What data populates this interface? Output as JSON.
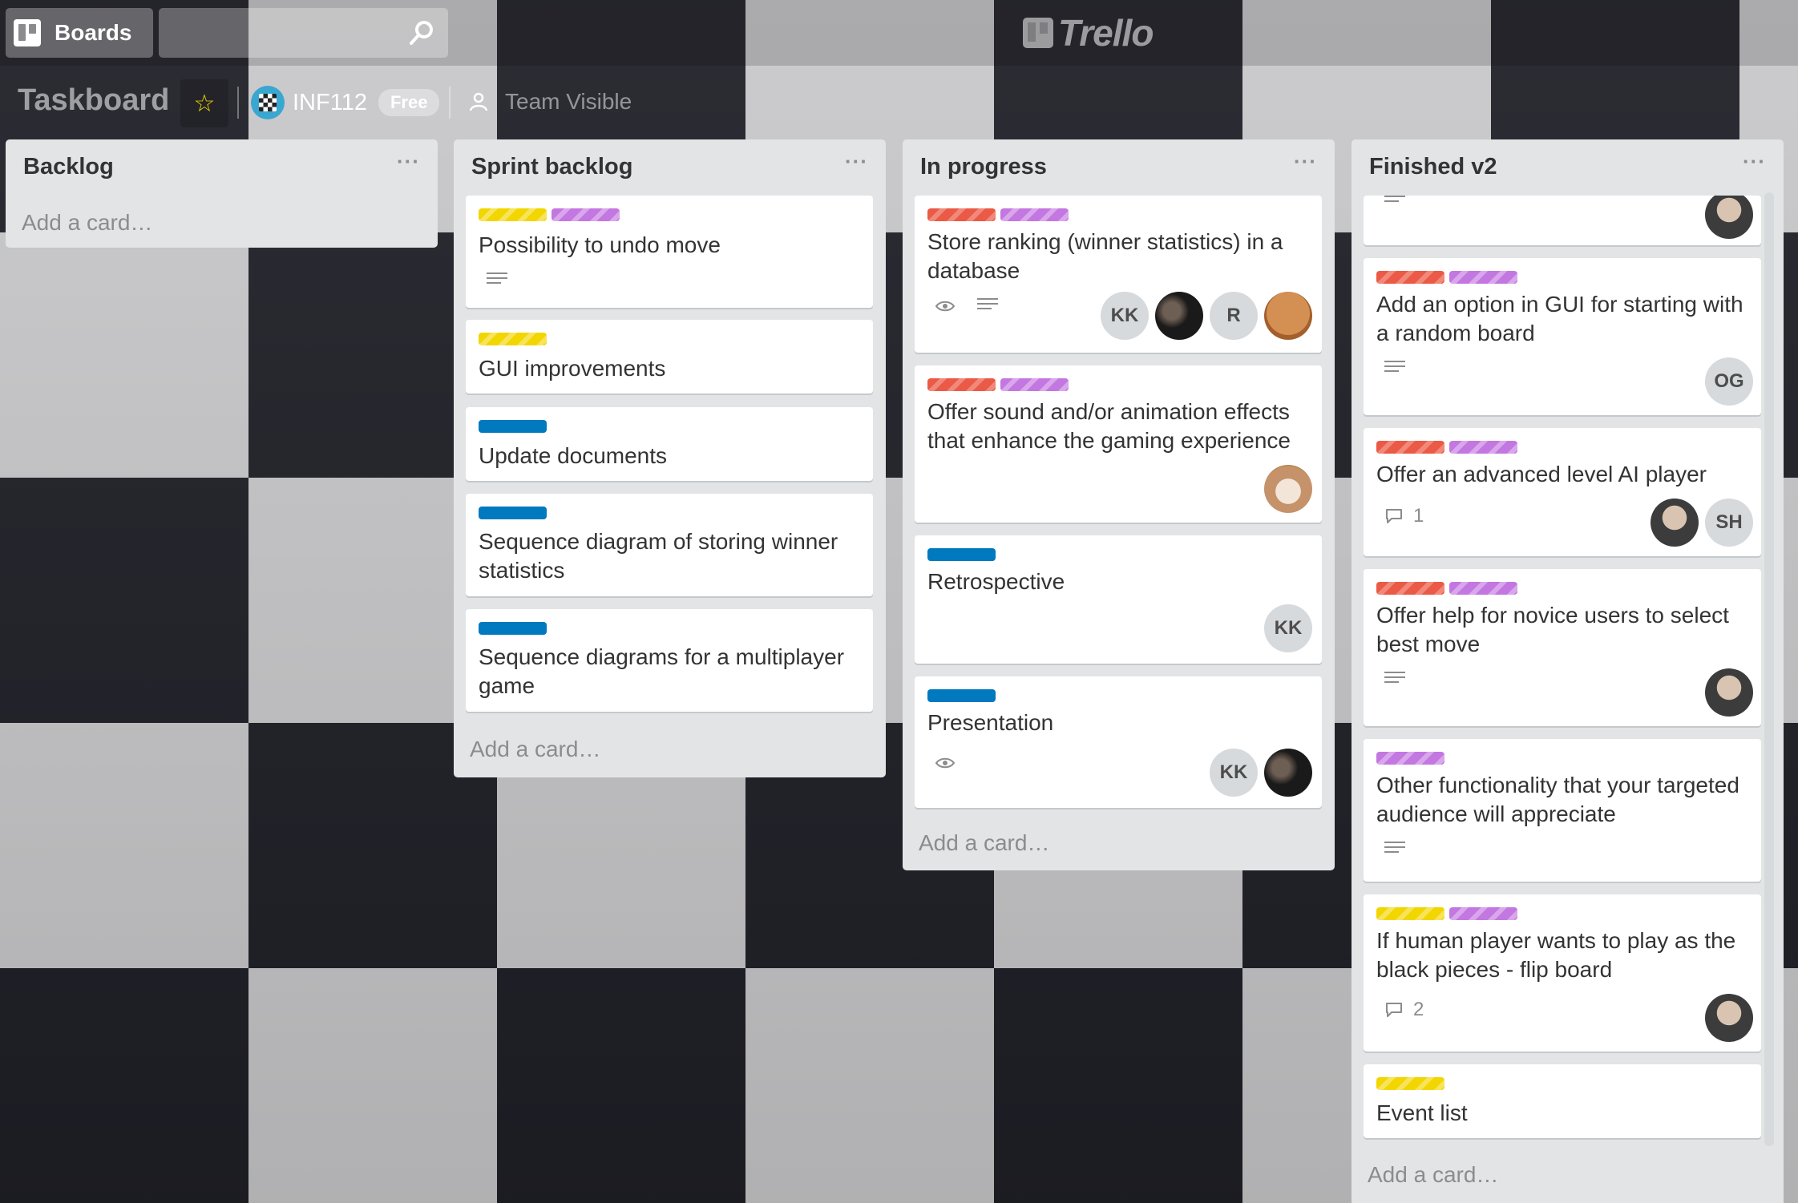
{
  "header": {
    "boards_label": "Boards",
    "search": {
      "value": "",
      "placeholder": ""
    },
    "logo_text": "Trello"
  },
  "board": {
    "title": "Taskboard",
    "starred": true,
    "org_name": "INF112",
    "org_badge": "Free",
    "visibility": "Team Visible"
  },
  "colors": {
    "label_yellow": "#f2d600",
    "label_red": "#eb5a46",
    "label_purple": "#c377e0",
    "label_blue": "#0079bf",
    "list_bg": "#e2e4e6"
  },
  "lists": [
    {
      "title": "Backlog",
      "menu": "···",
      "add_card": "Add a card…"
    },
    {
      "title": "Sprint backlog",
      "menu": "···",
      "add_card": "Add a card…",
      "cards": [
        {
          "text": "Possibility to undo move",
          "labels": [
            "yellow",
            "purple"
          ],
          "has_description": true
        },
        {
          "text": "GUI improvements",
          "labels": [
            "yellow"
          ]
        },
        {
          "text": "Update documents",
          "labels": [
            "blue"
          ]
        },
        {
          "text": "Sequence diagram of storing winner statistics",
          "labels": [
            "blue"
          ]
        },
        {
          "text": "Sequence diagrams for a multiplayer game",
          "labels": [
            "blue"
          ]
        }
      ]
    },
    {
      "title": "In progress",
      "menu": "···",
      "add_card": "Add a card…",
      "cards": [
        {
          "text": "Store ranking (winner statistics) in a database",
          "labels": [
            "red",
            "purple"
          ],
          "watching": true,
          "has_description": true,
          "members": [
            "KK",
            "photo-dark",
            "R",
            "emoji-avatar"
          ]
        },
        {
          "text": "Offer sound and/or animation effects that enhance the gaming experience",
          "labels": [
            "red",
            "purple"
          ],
          "members": [
            "cat-photo"
          ]
        },
        {
          "text": "Retrospective",
          "labels": [
            "blue"
          ],
          "members": [
            "KK"
          ]
        },
        {
          "text": "Presentation",
          "labels": [
            "blue"
          ],
          "watching": true,
          "members": [
            "KK",
            "photo-dark"
          ]
        }
      ]
    },
    {
      "title": "Finished v2",
      "menu": "···",
      "add_card": "Add a card…",
      "cards": [
        {
          "text": "",
          "partial": true,
          "has_description": true,
          "members": [
            "beard-photo"
          ]
        },
        {
          "text": "Add an option in GUI for starting with a random board",
          "labels": [
            "red",
            "purple"
          ],
          "has_description": true,
          "members": [
            "OG"
          ]
        },
        {
          "text": "Offer an advanced level AI player",
          "labels": [
            "red",
            "purple"
          ],
          "comments": "1",
          "members": [
            "beard-photo",
            "SH"
          ]
        },
        {
          "text": "Offer help for novice users to select best move",
          "labels": [
            "red",
            "purple"
          ],
          "has_description": true,
          "members": [
            "beard-photo"
          ]
        },
        {
          "text": "Other functionality that your targeted audience will appreciate",
          "labels": [
            "purple"
          ],
          "has_description": true
        },
        {
          "text": "If human player wants to play as the black pieces - flip board",
          "labels": [
            "yellow",
            "purple"
          ],
          "comments": "2",
          "members": [
            "beard-photo"
          ]
        },
        {
          "text": "Event list",
          "labels": [
            "yellow"
          ]
        }
      ]
    }
  ],
  "avatars": {
    "kk": "KK",
    "r": "R",
    "og": "OG",
    "sh": "SH"
  }
}
